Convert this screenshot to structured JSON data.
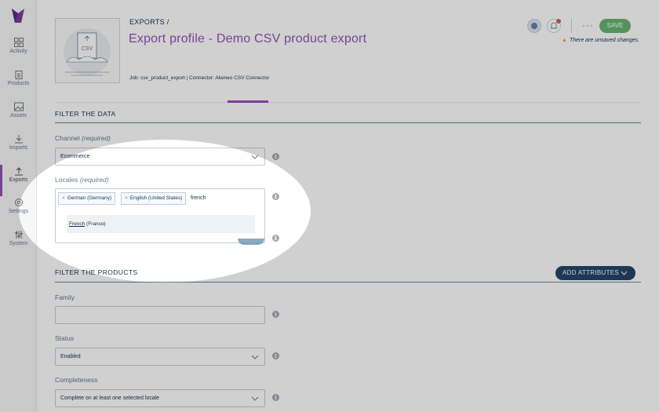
{
  "sidebar": {
    "items": [
      {
        "label": "Activity"
      },
      {
        "label": "Products"
      },
      {
        "label": "Assets"
      },
      {
        "label": "Imports"
      },
      {
        "label": "Exports"
      },
      {
        "label": "Settings"
      },
      {
        "label": "System"
      }
    ]
  },
  "header": {
    "breadcrumb": "EXPORTS /",
    "title": "Export profile - Demo CSV product export",
    "meta": "Job: csv_product_export | Connector: Akeneo CSV Connector",
    "thumbnail_label": "CSV",
    "save_label": "SAVE",
    "more_label": "···",
    "unsaved_text": "There are unsaved changes."
  },
  "filter_data": {
    "title": "FILTER THE DATA",
    "channel_label": "Channel",
    "channel_required": "(required)",
    "channel_value": "Ecommerce",
    "locales_label": "Locales",
    "locales_required": "(required)",
    "selected_locales": [
      "German (Germany)",
      "English (United States)"
    ],
    "chip_remove": "×",
    "search_value": "french",
    "suggestion_main": "French",
    "suggestion_rest": " (France)"
  },
  "filter_products": {
    "title": "FILTER THE PRODUCTS",
    "add_attributes_label": "ADD ATTRIBUTES",
    "family_label": "Family",
    "family_value": "",
    "status_label": "Status",
    "status_value": "Enabled",
    "completeness_label": "Completeness",
    "completeness_value": "Complete on at least one selected locale"
  },
  "colors": {
    "brand_purple": "#9452ba",
    "save_green": "#67b373",
    "add_attributes_blue": "#24466a"
  }
}
